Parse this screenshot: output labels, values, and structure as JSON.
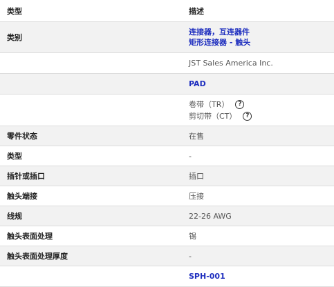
{
  "header": {
    "label": "类型",
    "value": "描述"
  },
  "category": {
    "label": "类别",
    "links": [
      "连接器，互连器件",
      "矩形连接器 - 触头"
    ]
  },
  "manufacturer": {
    "label": "",
    "value": "JST Sales America Inc."
  },
  "series": {
    "label": "",
    "value": "PAD"
  },
  "packaging": {
    "label": "",
    "items": [
      {
        "text": "卷带（TR）",
        "help_icon": "help-circle-icon"
      },
      {
        "text": "剪切带（CT）",
        "help_icon": "help-circle-icon"
      }
    ]
  },
  "rows": [
    {
      "label": "零件状态",
      "value": "在售"
    },
    {
      "label": "类型",
      "value": "-"
    },
    {
      "label": "插针或插口",
      "value": "插口"
    },
    {
      "label": "触头端接",
      "value": "压接"
    },
    {
      "label": "线规",
      "value": "22-26 AWG"
    },
    {
      "label": "触头表面处理",
      "value": "锡"
    },
    {
      "label": "触头表面处理厚度",
      "value": "-"
    }
  ],
  "mating_part": {
    "label": "",
    "value": "SPH-001"
  },
  "colors": {
    "link": "#1f2fbf",
    "shade": "#f2f2f2",
    "border": "#dcdcdc"
  }
}
